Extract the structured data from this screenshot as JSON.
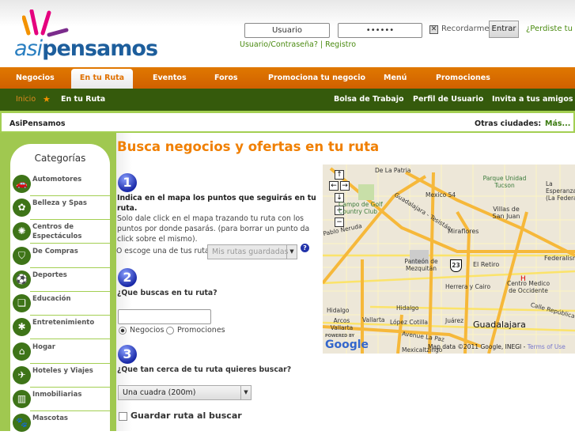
{
  "logo": {
    "text_a": "asi",
    "text_b": "pensamos"
  },
  "login": {
    "user_value": "Usuario",
    "password_value": "••••••",
    "remember_label": "Recordarme",
    "submit": "Entrar",
    "forgot": "¿Perdiste tu",
    "links": "Usuario/Contraseña? | Registro"
  },
  "nav": [
    "Negocios",
    "En tu Ruta",
    "Eventos",
    "Foros",
    "Promociona tu negocio",
    "Menú",
    "Promociones"
  ],
  "breadcrumb": {
    "home": "Inicio",
    "current": "En tu Ruta"
  },
  "subnav": [
    "Bolsa de Trabajo",
    "Perfil de Usuario",
    "Invita a tus amigos"
  ],
  "citybar": {
    "site": "AsiPensamos",
    "other": "Otras ciudades:",
    "more": "Más..."
  },
  "sidebar": {
    "title": "Categorías",
    "items": [
      "Automotores",
      "Belleza y Spas",
      "Centros de Espectáculos",
      "De Compras",
      "Deportes",
      "Educación",
      "Entretenimiento",
      "Hogar",
      "Hoteles y Viajes",
      "Inmobiliarias",
      "Mascotas"
    ]
  },
  "main": {
    "title": "Busca negocios y ofertas en tu ruta",
    "step1": {
      "num": "1",
      "bold": "Indica en el mapa los puntos que seguirás en tu ruta.",
      "text": "Solo dale click en el mapa trazando tu ruta con los puntos por donde pasarás. (para borrar un punto da click sobre el mismo).",
      "choose": "O escoge una de tus rutas",
      "select": "Mis rutas guardadas",
      "help": "?"
    },
    "step2": {
      "num": "2",
      "label": "¿Que buscas en tu ruta?",
      "search_value": "",
      "radio1": "Negocios",
      "radio2": "Promociones"
    },
    "step3": {
      "num": "3",
      "label": "¿Que tan cerca de tu ruta quieres buscar?",
      "select": "Una cuadra (200m)"
    },
    "save": "Guardar ruta al buscar"
  },
  "map": {
    "labels": [
      "De La Patria",
      "Parque Unidad Tucson",
      "La Esperanza (La Federal)",
      "Mexico 54",
      "Campo de Golf Country Club",
      "Villas de San Juan",
      "Guadalajara - Tesistán",
      "Pablo Neruda",
      "Miraflores",
      "Panteón de Mezquitán",
      "El Retiro",
      "Federalismo",
      "Centro Medico de Occidente",
      "Herrera y Cairo",
      "Hidalgo",
      "Calle República",
      "Arcos Vallarta",
      "Vallarta",
      "López Cotilla",
      "Juárez",
      "Guadalajara",
      "Avenue La Paz",
      "Mexicaltzingo",
      "23"
    ],
    "powered": "POWERED BY",
    "google": "Google",
    "attribution": "Map data ©2011 Google, INEGI -",
    "terms": "Terms of Use"
  }
}
